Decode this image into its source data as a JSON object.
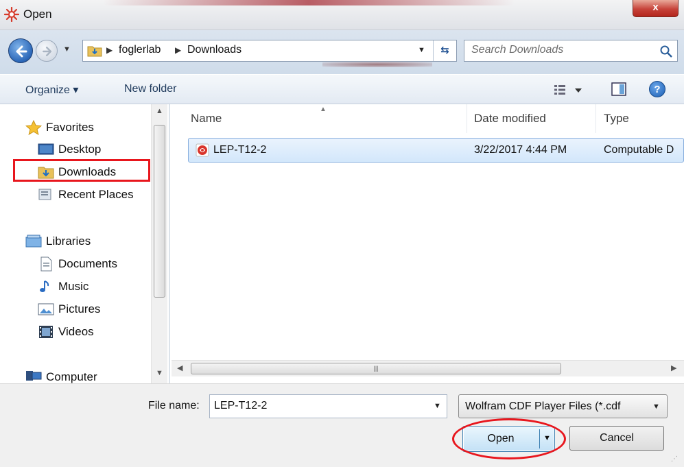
{
  "window": {
    "title": "Open",
    "close_label": "x"
  },
  "address": {
    "crumbs": [
      "foglerlab",
      "Downloads"
    ],
    "search_placeholder": "Search Downloads"
  },
  "toolbar": {
    "organize_label": "Organize ▾",
    "new_folder_label": "New folder"
  },
  "navigation": {
    "favorites": {
      "label": "Favorites",
      "items": [
        "Desktop",
        "Downloads",
        "Recent Places"
      ]
    },
    "libraries": {
      "label": "Libraries",
      "items": [
        "Documents",
        "Music",
        "Pictures",
        "Videos"
      ]
    },
    "computer": {
      "label": "Computer"
    },
    "selected": "Downloads"
  },
  "file_list": {
    "columns": [
      "Name",
      "Date modified",
      "Type"
    ],
    "rows": [
      {
        "name": "LEP-T12-2",
        "date_modified": "3/22/2017 4:44 PM",
        "type": "Computable D"
      }
    ]
  },
  "bottom": {
    "file_name_label": "File name:",
    "file_name_value": "LEP-T12-2",
    "filter_value": "Wolfram CDF Player Files (*.cdf",
    "open_label": "Open",
    "cancel_label": "Cancel"
  },
  "colors": {
    "annotation": "#e8161d",
    "accent": "#1d4f91"
  }
}
